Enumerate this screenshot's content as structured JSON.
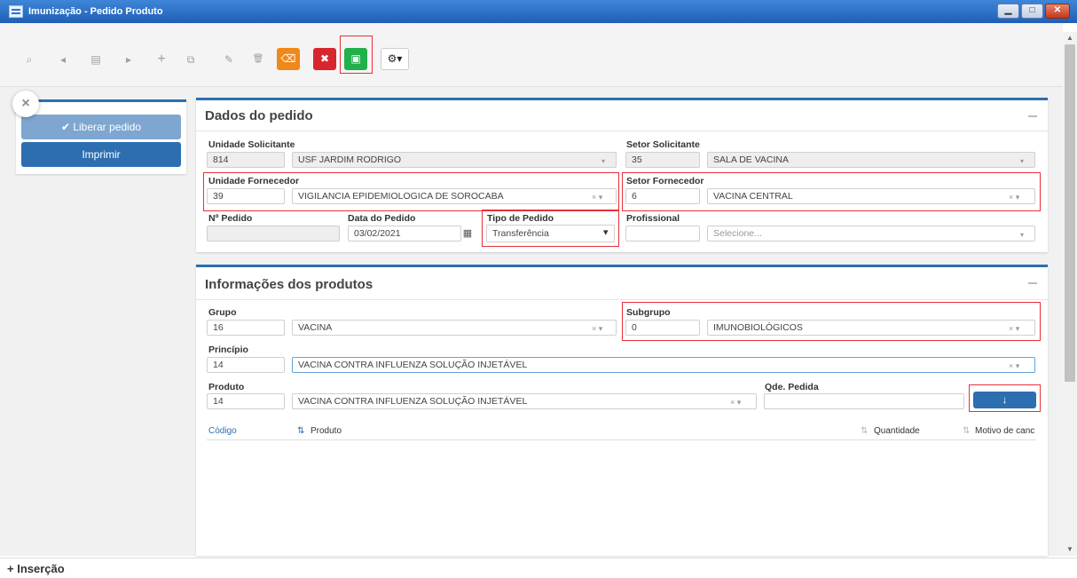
{
  "window": {
    "title": "Imunização - Pedido Produto",
    "minimize": "▁",
    "maximize": "□",
    "close": "✕"
  },
  "toolbar": {
    "icons": [
      "search-icon",
      "chevron-left-circle-icon",
      "list-icon",
      "chevron-right-circle-icon",
      "plus-icon",
      "copy-icon",
      "edit-icon",
      "trash-icon",
      "eraser-icon",
      "cancel-icon",
      "save-icon",
      "gear-icon"
    ],
    "glyphs": {
      "search": "⌕",
      "prev": "◂",
      "list": "▤",
      "next": "▸",
      "add": "+",
      "copy": "⧉",
      "edit": "✎",
      "del": "🗑",
      "erase": "⌫",
      "cancel": "✖",
      "save": "▣",
      "gear": "⚙▾"
    },
    "colors": {
      "erase": "#f0881a",
      "cancel": "#d8262f",
      "save": "#21b04b"
    }
  },
  "sidebar": {
    "close_glyph": "×",
    "release_label": "✔ Liberar pedido",
    "print_label": "Imprimir"
  },
  "order": {
    "title": "Dados do pedido",
    "unidade_solicitante": {
      "label": "Unidade Solicitante",
      "code": "814",
      "name": "USF JARDIM RODRIGO"
    },
    "setor_solicitante": {
      "label": "Setor Solicitante",
      "code": "35",
      "name": "SALA DE VACINA"
    },
    "unidade_fornecedor": {
      "label": "Unidade Fornecedor",
      "code": "39",
      "name": "VIGILANCIA EPIDEMIOLOGICA DE SOROCABA"
    },
    "setor_fornecedor": {
      "label": "Setor Fornecedor",
      "code": "6",
      "name": "VACINA CENTRAL"
    },
    "numero": {
      "label": "Nº Pedido",
      "value": ""
    },
    "data": {
      "label": "Data do Pedido",
      "value": "03/02/2021"
    },
    "tipo": {
      "label": "Tipo de Pedido",
      "value": "Transferência"
    },
    "profissional": {
      "label": "Profissional",
      "code": "",
      "placeholder": "Selecione..."
    }
  },
  "products": {
    "title": "Informações dos produtos",
    "grupo": {
      "label": "Grupo",
      "code": "16",
      "name": "VACINA"
    },
    "subgrupo": {
      "label": "Subgrupo",
      "code": "0",
      "name": "IMUNOBIOLÓGICOS"
    },
    "principio": {
      "label": "Princípio",
      "code": "14",
      "name": "VACINA CONTRA INFLUENZA SOLUÇÃO INJETÁVEL"
    },
    "produto": {
      "label": "Produto",
      "code": "14",
      "name": "VACINA CONTRA INFLUENZA SOLUÇÃO INJETÁVEL"
    },
    "qtde": {
      "label": "Qde. Pedida",
      "value": ""
    },
    "add_glyph": "↓",
    "table": {
      "columns": [
        "Código",
        "Produto",
        "Quantidade",
        "Motivo de canc"
      ]
    }
  },
  "clear_glyph": "× ▾",
  "dropdown_glyph": "▾",
  "footer": {
    "label": "+ Inserção"
  }
}
